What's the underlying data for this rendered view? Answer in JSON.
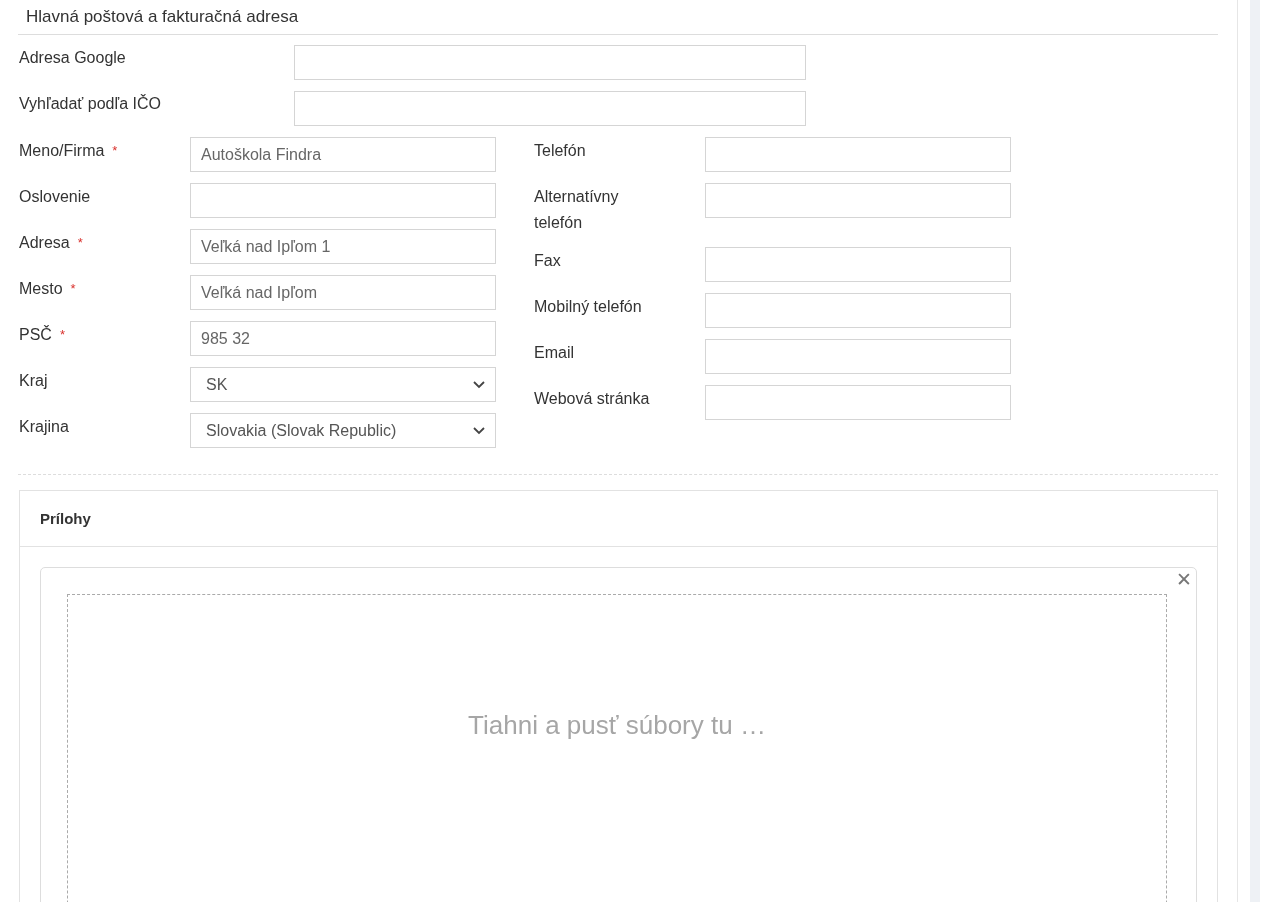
{
  "section_title": "Hlavná poštová a fakturačná adresa",
  "wide_fields": [
    {
      "label": "Adresa Google"
    },
    {
      "label": "Vyhľadať podľa IČO"
    }
  ],
  "left_fields": [
    {
      "label": "Meno/Firma",
      "required_mark": "*",
      "kind": "text",
      "value": "Autoškola Findra"
    },
    {
      "label": "Oslovenie",
      "kind": "text"
    },
    {
      "label": "Adresa",
      "required_mark": "*",
      "kind": "text",
      "value": "Veľká nad Ipľom 1"
    },
    {
      "label": "Mesto",
      "required_mark": "*",
      "kind": "text",
      "value": "Veľká nad Ipľom"
    },
    {
      "label": "PSČ",
      "required_mark": "*",
      "kind": "text",
      "value": "985 32"
    },
    {
      "label": "Kraj",
      "kind": "select",
      "value": "SK"
    },
    {
      "label": "Krajina",
      "kind": "select",
      "value": "Slovakia (Slovak Republic)"
    }
  ],
  "right_fields": [
    {
      "label": "Telefón"
    },
    {
      "label": "Alternatívny telefón"
    },
    {
      "label": "Fax"
    },
    {
      "label": "Mobilný telefón"
    },
    {
      "label": "Email"
    },
    {
      "label": "Webová stránka"
    }
  ],
  "attachments": {
    "title": "Prílohy",
    "close": "✕",
    "dropzone_text": "Tiahni a pusť súbory tu …"
  }
}
